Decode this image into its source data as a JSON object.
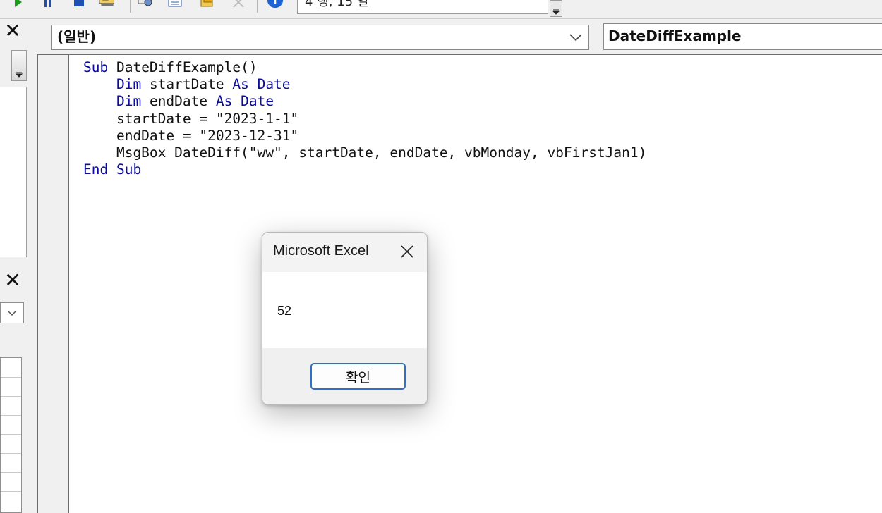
{
  "toolbar": {
    "status_text": "4 행, 15 열",
    "buttons": [
      {
        "name": "run-icon",
        "color": "#1a9a1a"
      },
      {
        "name": "break-icon",
        "color": "#1e4fb3"
      },
      {
        "name": "reset-icon",
        "color": "#1e4fb3"
      },
      {
        "name": "design-mode-icon"
      },
      {
        "name": "project-explorer-icon"
      },
      {
        "name": "properties-window-icon"
      },
      {
        "name": "object-browser-icon"
      },
      {
        "name": "toolbox-icon"
      },
      {
        "name": "help-icon",
        "color": "#1e63d6"
      }
    ]
  },
  "code_window": {
    "object_combo": "(일반)",
    "procedure_combo": "DateDiffExample",
    "lines": [
      [
        {
          "t": "Sub",
          "k": true
        },
        {
          "t": " DateDiffExample()",
          "k": false
        }
      ],
      [
        {
          "t": "    ",
          "k": false
        },
        {
          "t": "Dim",
          "k": true
        },
        {
          "t": " startDate ",
          "k": false
        },
        {
          "t": "As",
          "k": true
        },
        {
          "t": " ",
          "k": false
        },
        {
          "t": "Date",
          "k": true
        }
      ],
      [
        {
          "t": "    ",
          "k": false
        },
        {
          "t": "Dim",
          "k": true
        },
        {
          "t": " endDate ",
          "k": false
        },
        {
          "t": "As",
          "k": true
        },
        {
          "t": " ",
          "k": false
        },
        {
          "t": "Date",
          "k": true
        }
      ],
      [
        {
          "t": "    startDate = \"2023-1-1\"",
          "k": false
        }
      ],
      [
        {
          "t": "    endDate = \"2023-12-31\"",
          "k": false
        }
      ],
      [
        {
          "t": "    MsgBox DateDiff(\"ww\", startDate, endDate, vbMonday, vbFirstJan1)",
          "k": false
        }
      ],
      [
        {
          "t": "End",
          "k": true
        },
        {
          "t": " ",
          "k": false
        },
        {
          "t": "Sub",
          "k": true
        }
      ]
    ],
    "keyword_color": "#0b0b9c"
  },
  "dialog": {
    "title": "Microsoft Excel",
    "message": "52",
    "ok_label": "확인"
  }
}
